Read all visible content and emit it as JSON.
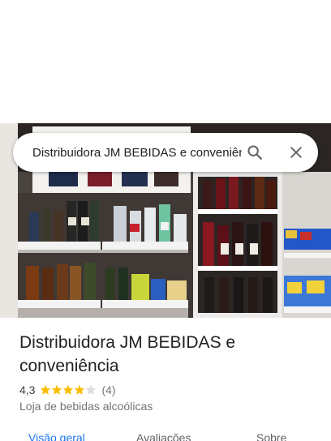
{
  "search": {
    "value": "Distribuidora JM BEBIDAS e conveniência",
    "search_icon": "search-icon",
    "close_icon": "close-icon"
  },
  "place": {
    "name": "Distribuidora JM BEBIDAS e conveniência",
    "rating": "4,3",
    "rating_fraction": 0.86,
    "review_count": "(4)",
    "category": "Loja de bebidas alcoólicas"
  },
  "tabs": [
    {
      "label": "Visão geral",
      "active": true
    },
    {
      "label": "Avaliações",
      "active": false
    },
    {
      "label": "Sobre",
      "active": false
    }
  ],
  "colors": {
    "star": "#fbbc04",
    "accent": "#1a73e8",
    "text_primary": "#202124",
    "text_secondary": "#70757a"
  }
}
